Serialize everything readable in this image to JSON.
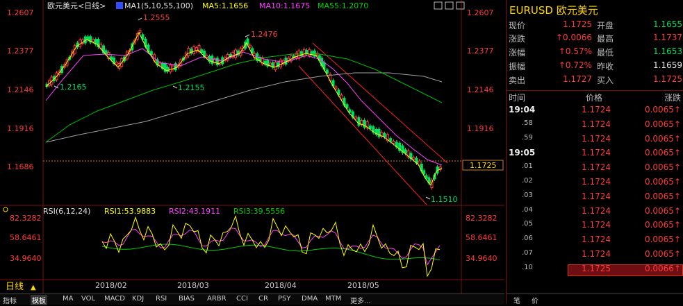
{
  "header": {
    "title": "欧元美元<日线>",
    "ma_label": "MA1(5,10,55,100)",
    "ma5": "MA5:1.1656",
    "ma10": "MA10:1.1675",
    "ma55": "MA55:1.2070"
  },
  "price_axis": [
    "1.2607",
    "1.2377",
    "1.2146",
    "1.1916",
    "1.1686"
  ],
  "current_price_tag": "1.1725",
  "annotations": {
    "high1": "1.2555",
    "high2": "1.2476",
    "low1": "1.2165",
    "low2": "1.2155",
    "low3": "1.1510"
  },
  "rsi": {
    "label": "RSI(6,12,24)",
    "rsi1": "RSI1:53.9883",
    "rsi2": "RSI2:43.1911",
    "rsi3": "RSI3:39.5556",
    "axis": [
      "82.3282",
      "58.6461",
      "34.9640"
    ]
  },
  "period": "日线",
  "dates": [
    "2018/02",
    "2018/03",
    "2018/04",
    "2018/05"
  ],
  "tabs": [
    "指标",
    "模板",
    "MA",
    "VOL",
    "MACD",
    "KDJ",
    "RSI",
    "BIAS",
    "ARBR",
    "CCI",
    "CR",
    "PSY",
    "DMA",
    "MTM",
    "更多..."
  ],
  "quote": {
    "symbol": "EURUSD 欧元美元",
    "rows": [
      {
        "l1": "现价",
        "v1": "1.1725",
        "c1": "red",
        "l2": "开盘",
        "v2": "1.1655",
        "c2": "green"
      },
      {
        "l1": "涨跌",
        "v1": "↑0.0066",
        "c1": "red",
        "l2": "最高",
        "v2": "1.1737",
        "c2": "red"
      },
      {
        "l1": "涨幅",
        "v1": "↑0.57%",
        "c1": "red",
        "l2": "最低",
        "v2": "1.1653",
        "c2": "green"
      },
      {
        "l1": "振幅",
        "v1": "↑0.72%",
        "c1": "red",
        "l2": "昨收",
        "v2": "1.1659",
        "c2": "white"
      },
      {
        "l1": "卖出",
        "v1": "1.1727",
        "c1": "red",
        "l2": "买入",
        "v2": "1.1725",
        "c2": "red"
      }
    ]
  },
  "ticks_header": {
    "time": "时间",
    "price": "价格",
    "change": "涨跌"
  },
  "ticks": [
    {
      "t": "19:04",
      "p": "1.1724",
      "c": "0.0065↑",
      "big": true
    },
    {
      "t": ".58",
      "p": "1.1724",
      "c": "0.0065↑",
      "big": false
    },
    {
      "t": ".59",
      "p": "1.1724",
      "c": "0.0065↑",
      "big": false
    },
    {
      "t": "19:05",
      "p": "1.1724",
      "c": "0.0065↑",
      "big": true
    },
    {
      "t": ".01",
      "p": "1.1724",
      "c": "0.0065↑",
      "big": false
    },
    {
      "t": ".02",
      "p": "1.1724",
      "c": "0.0065↑",
      "big": false
    },
    {
      "t": ".03",
      "p": "1.1724",
      "c": "0.0065↑",
      "big": false
    },
    {
      "t": ".04",
      "p": "1.1724",
      "c": "0.0065↑",
      "big": false
    },
    {
      "t": ".05",
      "p": "1.1724",
      "c": "0.0065↑",
      "big": false
    },
    {
      "t": ".06",
      "p": "1.1724",
      "c": "0.0065↑",
      "big": false
    },
    {
      "t": ".07",
      "p": "1.1724",
      "c": "0.0065↑",
      "big": false
    },
    {
      "t": ".10",
      "p": "1.1725",
      "c": "0.0066↑",
      "big": false
    }
  ],
  "right_tabs": [
    "笔",
    "价"
  ],
  "colors": {
    "up": "#ff3b3b",
    "down": "#00e060",
    "ma5": "#ffff00",
    "ma10": "#ff40ff",
    "ma55": "#00d000",
    "ma100": "#a0a0a0",
    "channel": "#ff2020"
  }
}
